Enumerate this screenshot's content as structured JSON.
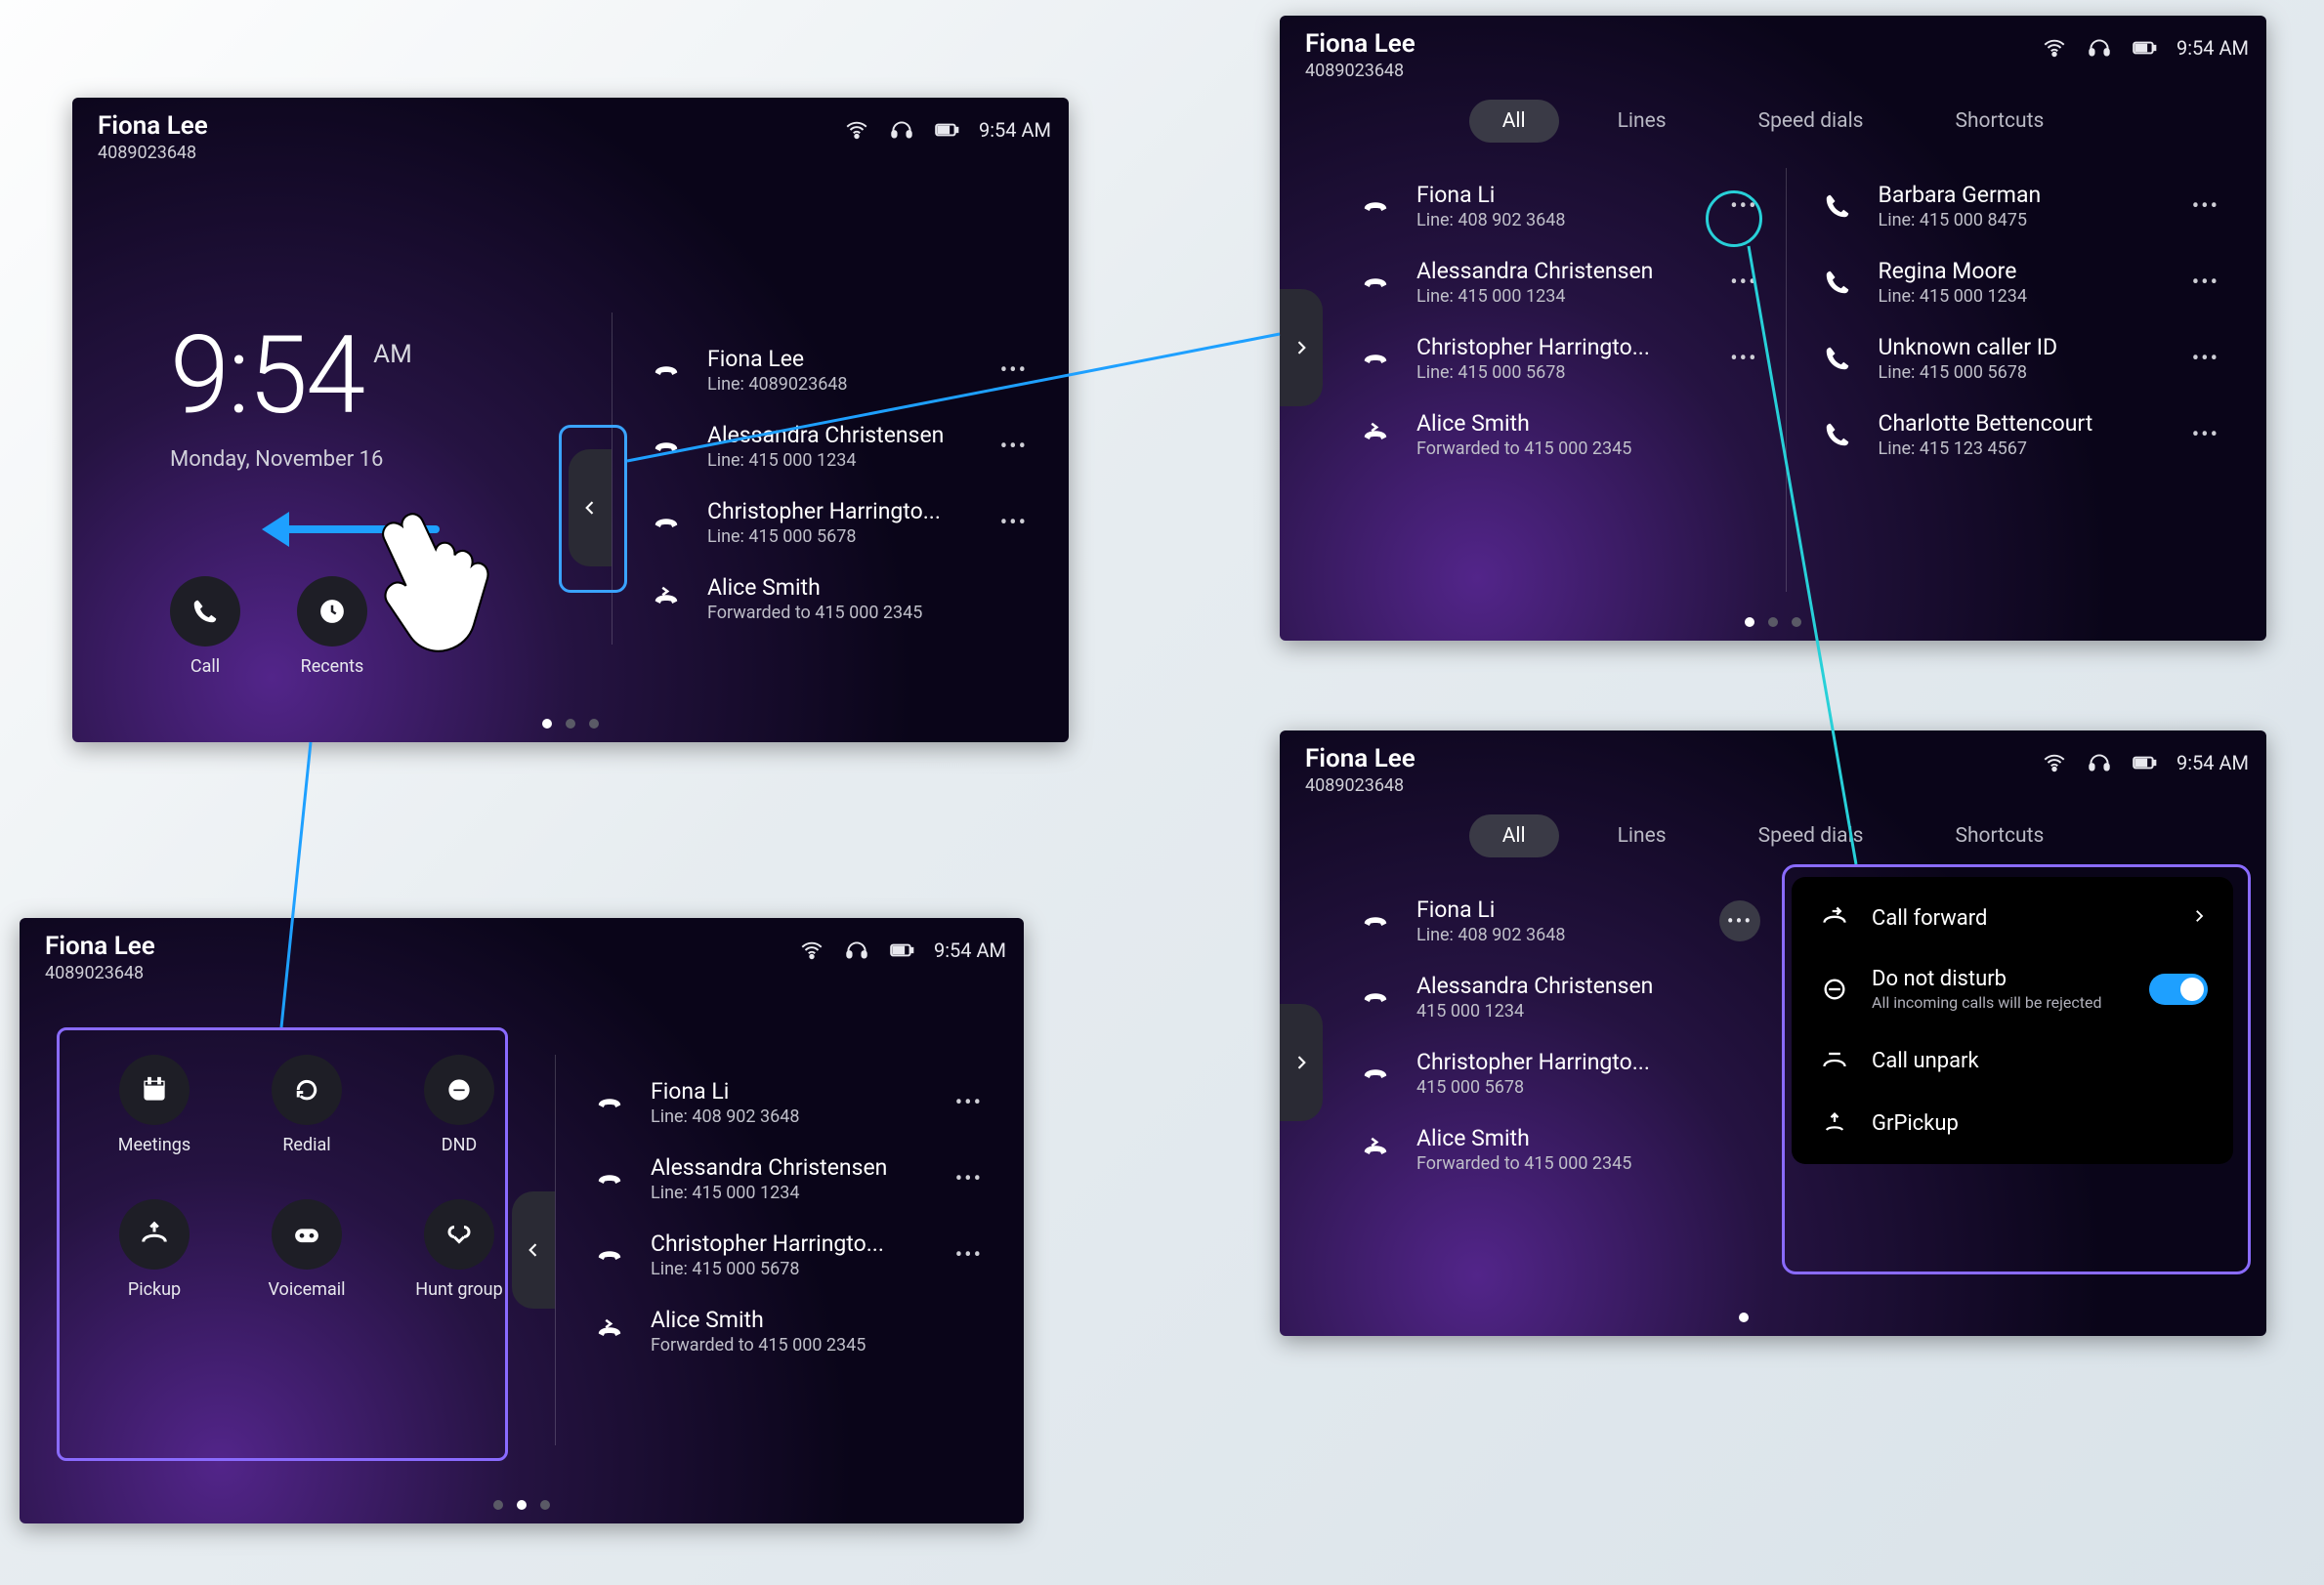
{
  "header": {
    "name": "Fiona Lee",
    "number": "4089023648",
    "time": "9:54 AM"
  },
  "panelA": {
    "clock": {
      "time": "9:54",
      "ampm": "AM",
      "date": "Monday, November 16"
    },
    "buttons": {
      "call": "Call",
      "recents": "Recents"
    },
    "list": [
      {
        "icon": "hangup",
        "l1": "Fiona Lee",
        "l2": "Line: 4089023648"
      },
      {
        "icon": "hangup",
        "l1": "Alessandra Christensen",
        "l2": "Line: 415 000 1234"
      },
      {
        "icon": "hangup",
        "l1": "Christopher Harringto...",
        "l2": "Line: 415 000 5678"
      },
      {
        "icon": "forward",
        "l1": "Alice Smith",
        "l2": "Forwarded to 415 000 2345"
      }
    ]
  },
  "tabs": {
    "all": "All",
    "lines": "Lines",
    "speed": "Speed dials",
    "shortcuts": "Shortcuts"
  },
  "panelB": {
    "left": [
      {
        "icon": "hangup",
        "l1": "Fiona Li",
        "l2": "Line: 408 902 3648"
      },
      {
        "icon": "hangup",
        "l1": "Alessandra Christensen",
        "l2": "Line: 415 000 1234"
      },
      {
        "icon": "hangup",
        "l1": "Christopher Harringto...",
        "l2": "Line: 415 000 5678"
      },
      {
        "icon": "forward",
        "l1": "Alice Smith",
        "l2": "Forwarded to 415 000 2345"
      }
    ],
    "right": [
      {
        "icon": "phone",
        "l1": "Barbara German",
        "l2": "Line: 415 000 8475"
      },
      {
        "icon": "phone",
        "l1": "Regina Moore",
        "l2": "Line: 415 000 1234"
      },
      {
        "icon": "phone",
        "l1": "Unknown caller ID",
        "l2": "Line: 415 000 5678"
      },
      {
        "icon": "phone",
        "l1": "Charlotte Bettencourt",
        "l2": "Line: 415 123 4567"
      }
    ]
  },
  "panelC": {
    "apps": {
      "meetings": "Meetings",
      "redial": "Redial",
      "dnd": "DND",
      "pickup": "Pickup",
      "voicemail": "Voicemail",
      "huntgroup": "Hunt group"
    },
    "list": [
      {
        "icon": "hangup",
        "l1": "Fiona Li",
        "l2": "Line: 408 902 3648"
      },
      {
        "icon": "hangup",
        "l1": "Alessandra Christensen",
        "l2": "Line: 415 000 1234"
      },
      {
        "icon": "hangup",
        "l1": "Christopher Harringto...",
        "l2": "Line: 415 000 5678"
      },
      {
        "icon": "forward",
        "l1": "Alice Smith",
        "l2": "Forwarded to 415 000 2345"
      }
    ]
  },
  "panelD": {
    "left": [
      {
        "icon": "hangup",
        "l1": "Fiona Li",
        "l2": "Line: 408 902 3648"
      },
      {
        "icon": "hangup",
        "l1": "Alessandra Christensen",
        "l2": "415 000 1234"
      },
      {
        "icon": "hangup",
        "l1": "Christopher Harringto...",
        "l2": "415 000 5678"
      },
      {
        "icon": "forward",
        "l1": "Alice Smith",
        "l2": "Forwarded to 415 000 2345"
      }
    ],
    "popover": {
      "forward": "Call forward",
      "dnd_title": "Do not disturb",
      "dnd_sub": "All incoming calls will be rejected",
      "unpark": "Call unpark",
      "grpickup": "GrPickup"
    }
  }
}
